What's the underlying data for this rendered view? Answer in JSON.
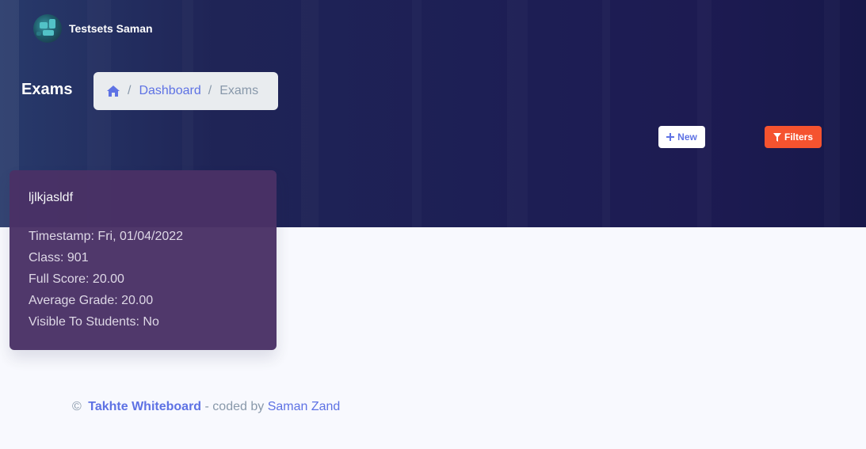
{
  "header": {
    "user_name": "Testsets Saman",
    "avatar_icon": "avatar-icon"
  },
  "page": {
    "title": "Exams"
  },
  "breadcrumb": {
    "home_icon": "home-icon",
    "sep": "/",
    "items": [
      "Dashboard",
      "Exams"
    ]
  },
  "actions": {
    "new_label": "New",
    "filters_label": "Filters"
  },
  "exam_card": {
    "title": "ljlkjasldf",
    "timestamp": "Timestamp: Fri, 01/04/2022",
    "class": "Class: 901",
    "full_score": "Full Score: 20.00",
    "average_grade": "Average Grade: 20.00",
    "visible": "Visible To Students: No"
  },
  "footer": {
    "copyright": "©",
    "brand": "Takhte Whiteboard",
    "coded_by": "- coded by",
    "author": "Saman Zand"
  },
  "colors": {
    "accent": "#5e72e4",
    "danger": "#f5532f",
    "hero_bg": "#1d1f55",
    "card_bg": "#4a3166"
  }
}
